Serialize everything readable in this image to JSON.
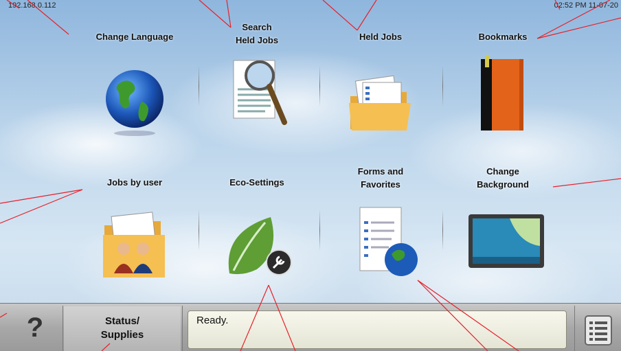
{
  "status_line": {
    "ip_address": "192.168.0.112",
    "clock": "02:52 PM 11-07-20"
  },
  "tiles": [
    {
      "label": "Change Language",
      "icon": "globe-icon"
    },
    {
      "label": "Search\nHeld Jobs",
      "icon": "magnifier-document-icon"
    },
    {
      "label": "Held Jobs",
      "icon": "folder-documents-icon"
    },
    {
      "label": "Bookmarks",
      "icon": "book-icon"
    },
    {
      "label": "Jobs by user",
      "icon": "folder-users-icon"
    },
    {
      "label": "Eco-Settings",
      "icon": "leaf-wrench-icon"
    },
    {
      "label": "Forms and\nFavorites",
      "icon": "form-globe-icon"
    },
    {
      "label": "Change\nBackground",
      "icon": "monitor-icon"
    }
  ],
  "bottom_bar": {
    "help_label": "?",
    "status_label_1": "Status/",
    "status_label_2": "Supplies",
    "message": "Ready.",
    "menu_icon": "list-menu-icon"
  },
  "colors": {
    "annotation": "#e8202a",
    "background_sky": "#b9d3ea"
  }
}
